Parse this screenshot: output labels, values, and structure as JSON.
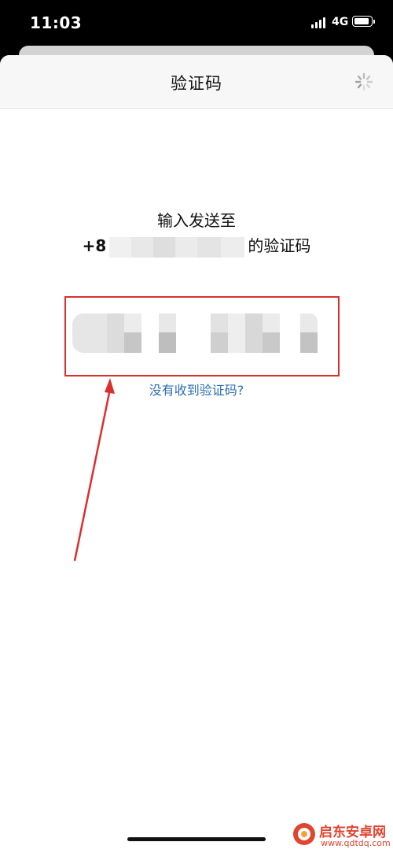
{
  "status_bar": {
    "time": "11:03",
    "network": "4G"
  },
  "nav": {
    "title": "验证码",
    "loading_icon": "spinner-icon"
  },
  "prompt": {
    "line1": "输入发送至",
    "phone_prefix": "+8",
    "line2_suffix": "的验证码"
  },
  "resend_link": "没有收到验证码?",
  "annotation": {
    "box_color": "#d9302e",
    "arrow_color": "#d9302e"
  },
  "watermark": {
    "name": "启东安卓网",
    "url": "www.qdtdq.com"
  }
}
